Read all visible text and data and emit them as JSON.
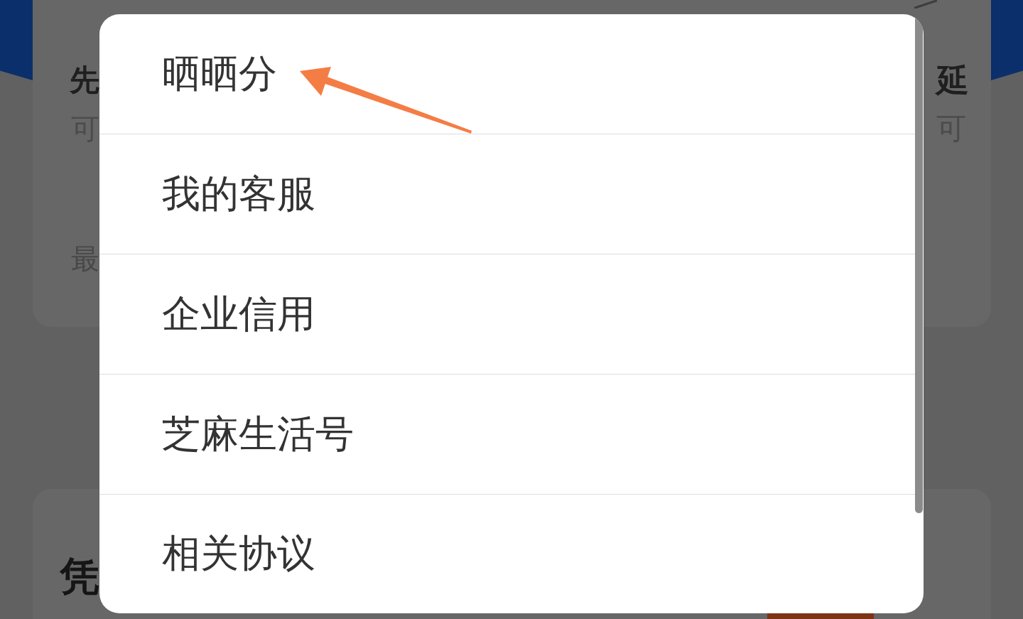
{
  "background": {
    "cards": [
      {
        "left_column": [
          {
            "kind": "heading",
            "text": "先"
          },
          {
            "kind": "subtext",
            "text": "可"
          },
          {
            "kind": "note",
            "text": "最"
          }
        ],
        "right_column": [
          {
            "kind": "heading",
            "text": "延"
          },
          {
            "kind": "subtext",
            "text": "可"
          }
        ]
      },
      {
        "left_column": [
          {
            "kind": "title",
            "text": "凭"
          }
        ]
      }
    ]
  },
  "menu": {
    "items": [
      {
        "label": "晒晒分"
      },
      {
        "label": "我的客服"
      },
      {
        "label": "企业信用"
      },
      {
        "label": "芝麻生活号"
      },
      {
        "label": "相关协议"
      }
    ]
  }
}
